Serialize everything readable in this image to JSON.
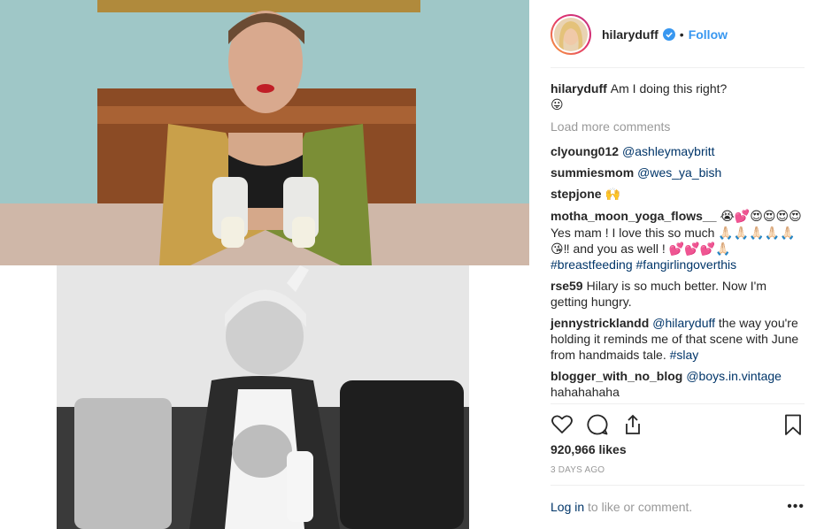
{
  "header": {
    "username": "hilaryduff",
    "separator": "•",
    "follow_label": "Follow"
  },
  "caption": {
    "username": "hilaryduff",
    "text": "Am I doing this right?",
    "emoji": "😛"
  },
  "load_more_label": "Load more comments",
  "comments": [
    {
      "user": "clyoung012",
      "mention": "@ashleymaybritt",
      "text": ""
    },
    {
      "user": "summiesmom",
      "mention": "@wes_ya_bish",
      "text": ""
    },
    {
      "user": "stepjone",
      "mention": "",
      "text": "🙌"
    },
    {
      "user": "motha_moon_yoga_flows__",
      "pre": "😭💕😍😍😍😍",
      "text": "Yes mam ! I love this so much 🙏🏻🙏🏻🙏🏻🙏🏻🙏🏻😘‼ and you as well ! 💕💕💕🙏🏻",
      "hashtags": "#breastfeeding #fangirlingoverthis"
    },
    {
      "user": "rse59",
      "mention": "",
      "text": "Hilary is so much better. Now I'm getting hungry."
    },
    {
      "user": "jennystricklandd",
      "mention": "@hilaryduff",
      "text": "the way you're holding it reminds me of that scene with June from handmaids tale.",
      "hashtag": "#slay"
    },
    {
      "user": "blogger_with_no_blog",
      "mention": "@boys.in.vintage",
      "text": "hahahahaha"
    }
  ],
  "likes_text": "920,966 likes",
  "timestamp": "3 DAYS AGO",
  "footer": {
    "login_label": "Log in",
    "rest": "to like or comment.",
    "more_label": "•••"
  },
  "colors": {
    "accent": "#3897f0",
    "mention": "#003569",
    "muted": "#999999",
    "text": "#262626"
  }
}
